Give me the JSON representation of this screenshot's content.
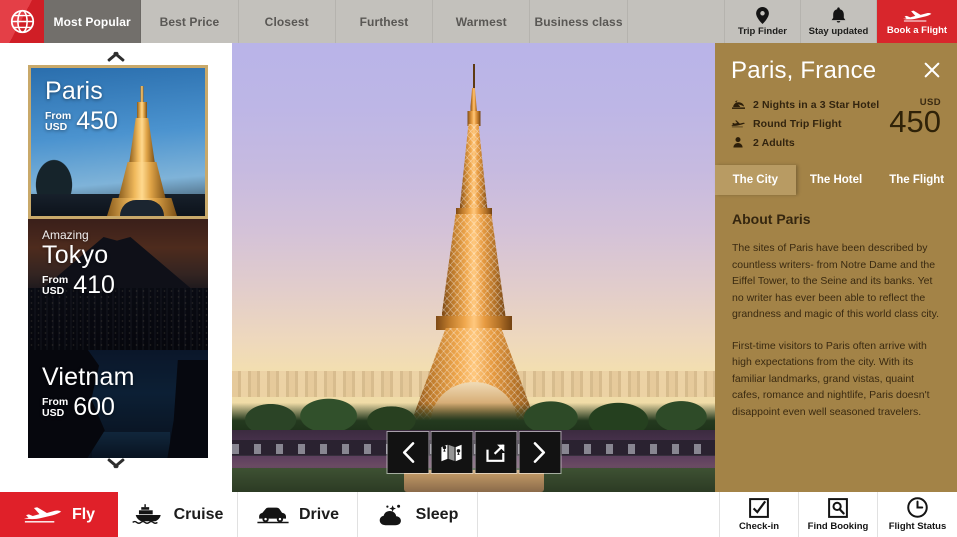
{
  "topbar": {
    "logo_icon": "globe-icon",
    "tabs": [
      {
        "label": "Most Popular",
        "active": true
      },
      {
        "label": "Best Price",
        "active": false
      },
      {
        "label": "Closest",
        "active": false
      },
      {
        "label": "Furthest",
        "active": false
      },
      {
        "label": "Warmest",
        "active": false
      },
      {
        "label": "Business class",
        "active": false
      },
      {
        "label": "",
        "active": false
      }
    ],
    "trip_finder": {
      "label": "Trip Finder",
      "icon": "location-pin-icon"
    },
    "stay_updated": {
      "label": "Stay updated",
      "icon": "bell-icon"
    },
    "book_flight": {
      "label": "Book a Flight",
      "icon": "airplane-icon"
    }
  },
  "sidebar": {
    "scroll_up_icon": "chevron-up-icon",
    "scroll_down_icon": "chevron-down-icon",
    "cards": [
      {
        "sub": "",
        "city": "Paris",
        "from": "From",
        "currency": "USD",
        "price": "450",
        "selected": true
      },
      {
        "sub": "Amazing",
        "city": "Tokyo",
        "from": "From",
        "currency": "USD",
        "price": "410",
        "selected": false
      },
      {
        "sub": "",
        "city": "Vietnam",
        "from": "From",
        "currency": "USD",
        "price": "600",
        "selected": false
      }
    ]
  },
  "hero": {
    "alt": "Eiffel Tower at sunset, Paris",
    "controls": [
      {
        "name": "previous-image-button",
        "icon": "chevron-left-icon"
      },
      {
        "name": "map-button",
        "icon": "map-icon"
      },
      {
        "name": "share-button",
        "icon": "share-icon"
      },
      {
        "name": "next-image-button",
        "icon": "chevron-right-icon"
      }
    ]
  },
  "panel": {
    "title": "Paris, France",
    "close_icon": "close-icon",
    "facts": [
      {
        "icon": "hotel-bed-icon",
        "text": "2 Nights in a 3 Star Hotel"
      },
      {
        "icon": "airplane-icon",
        "text": "Round Trip Flight"
      },
      {
        "icon": "person-icon",
        "text": "2 Adults"
      }
    ],
    "price": {
      "currency": "USD",
      "value": "450"
    },
    "tabs": [
      {
        "label": "The City",
        "active": true
      },
      {
        "label": "The Hotel",
        "active": false
      },
      {
        "label": "The Flight",
        "active": false
      }
    ],
    "about_heading": "About Paris",
    "paragraphs": [
      "The sites of Paris have been described by countless writers- from Notre Dame and the Eiffel Tower, to the Seine and its banks. Yet no writer has ever been able to reflect the grandness and magic of this world class city.",
      "First-time visitors to Paris often arrive with high expectations from the city. With its familiar landmarks, grand vistas, quaint cafes, romance and nightlife, Paris doesn't disappoint even well seasoned travelers."
    ]
  },
  "bottombar": {
    "nav": [
      {
        "label": "Fly",
        "icon": "airplane-icon",
        "active": true
      },
      {
        "label": "Cruise",
        "icon": "ship-icon",
        "active": false
      },
      {
        "label": "Drive",
        "icon": "car-icon",
        "active": false
      },
      {
        "label": "Sleep",
        "icon": "moon-cloud-icon",
        "active": false
      }
    ],
    "actions": [
      {
        "label": "Check-in",
        "icon": "checkbox-check-icon"
      },
      {
        "label": "Find Booking",
        "icon": "search-box-icon"
      },
      {
        "label": "Flight Status",
        "icon": "clock-icon"
      }
    ]
  },
  "colors": {
    "brand_red": "#e02029",
    "panel_gold": "#a38347",
    "panel_gold_active": "#b89b63",
    "topbar_gray": "#c3c1bc",
    "topbar_active": "#726f6b"
  }
}
